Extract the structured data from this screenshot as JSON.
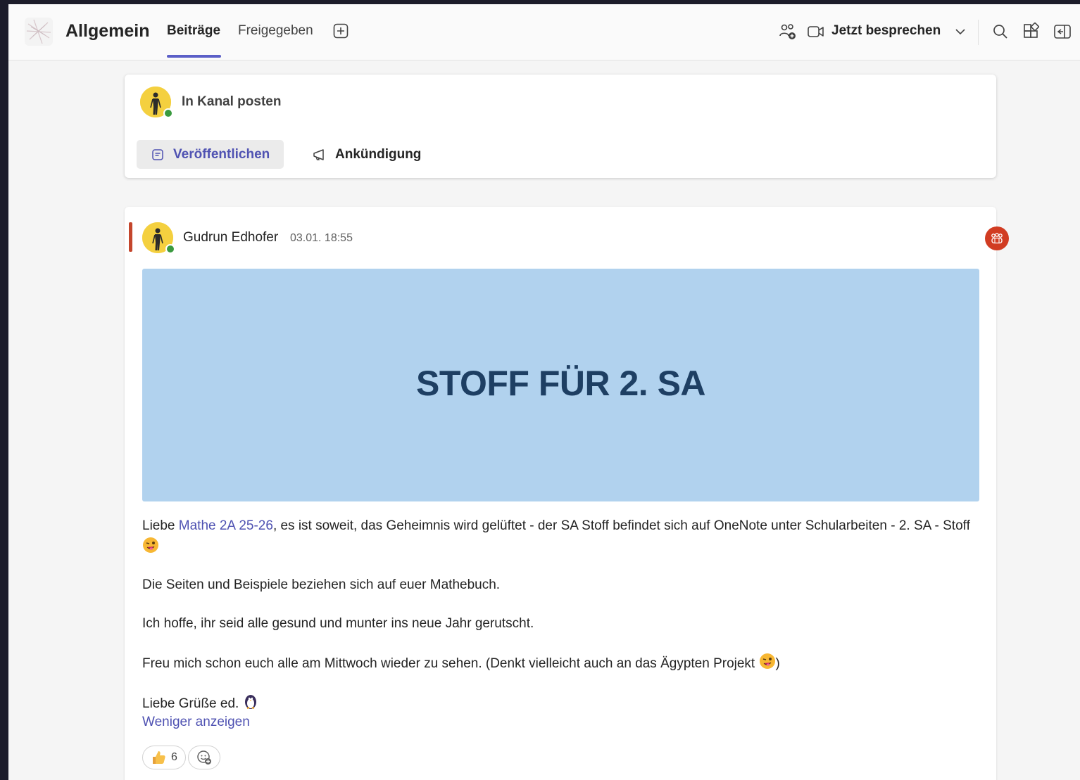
{
  "header": {
    "channel_title": "Allgemein",
    "tabs": [
      {
        "label": "Beiträge",
        "active": true
      },
      {
        "label": "Freigegeben",
        "active": false
      }
    ],
    "meet_label": "Jetzt besprechen",
    "accent_color": "#5b5fc7"
  },
  "compose": {
    "label": "In Kanal posten",
    "publish_label": "Veröffentlichen",
    "announce_label": "Ankündigung"
  },
  "post": {
    "author": "Gudrun Edhofer",
    "timestamp": "03.01. 18:55",
    "banner_title": "STOFF FÜR 2. SA",
    "line1_prefix": "Liebe ",
    "mention": "Mathe 2A 25-26",
    "line1_suffix": ", es ist soweit, das Geheimnis wird gelüftet - der SA Stoff befindet sich auf OneNote unter Schularbeiten - 2. SA - Stoff",
    "paragraph2": "Die Seiten und Beispiele beziehen sich auf euer Mathebuch.",
    "paragraph3": "Ich hoffe, ihr seid alle gesund und munter ins neue Jahr gerutscht.",
    "paragraph4": "Freu mich schon euch alle am Mittwoch wieder zu sehen. (Denkt vielleicht auch an das Ägypten Projekt",
    "paragraph4_end": ")",
    "signature": "Liebe Grüße ed.",
    "show_less": "Weniger anzeigen",
    "reactions": {
      "like_count": "6"
    }
  },
  "icons": [
    "team-logo-icon",
    "add-tab-icon",
    "people-add-icon",
    "video-camera-icon",
    "chevron-down-icon",
    "search-icon",
    "apps-icon",
    "side-panel-icon",
    "post-icon",
    "megaphone-icon",
    "mention-group-icon",
    "wink-emoji-icon",
    "penguin-emoji-icon",
    "thumbs-up-icon",
    "add-reaction-icon"
  ],
  "colors": {
    "important_bar": "#c4462c",
    "mention_badge": "#d13c22",
    "banner_bg": "#b1d2ee",
    "banner_text": "#1e3f63",
    "link": "#4f52b2"
  }
}
